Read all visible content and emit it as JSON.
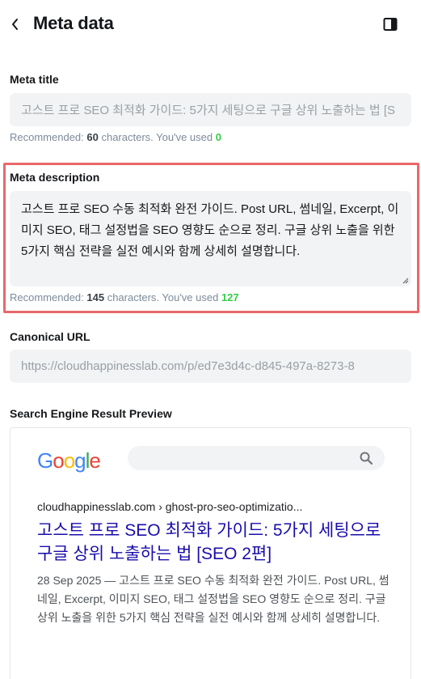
{
  "header": {
    "title": "Meta data",
    "back_icon": "chevron-left-icon",
    "panel_icon": "sidebar-panel-icon"
  },
  "meta_title": {
    "label": "Meta title",
    "placeholder": "고스트 프로 SEO 최적화 가이드: 5가지 세팅으로 구글 상위 노출하는 법 [S",
    "hint_prefix": "Recommended: ",
    "recommended": "60",
    "hint_mid": " characters. You've used ",
    "used": "0"
  },
  "meta_description": {
    "label": "Meta description",
    "value": "고스트 프로 SEO 수동 최적화 완전 가이드. Post URL, 썸네일, Excerpt, 이미지 SEO, 태그 설정법을 SEO 영향도 순으로 정리. 구글 상위 노출을 위한 5가지 핵심 전략을 실전 예시와 함께 상세히 설명합니다.",
    "hint_prefix": "Recommended: ",
    "recommended": "145",
    "hint_mid": " characters. You've used ",
    "used": "127"
  },
  "canonical": {
    "label": "Canonical URL",
    "placeholder": "https://cloudhappinesslab.com/p/ed7e3d4c-d845-497a-8273-8"
  },
  "preview": {
    "label": "Search Engine Result Preview",
    "logo_text": "Google",
    "search_icon": "magnifier-icon",
    "url": "cloudhappinesslab.com › ghost-pro-seo-optimizatio...",
    "title": "고스트 프로 SEO 최적화 가이드: 5가지 세팅으로 구글 상위 노출하는 법 [SEO 2편]",
    "description": "28 Sep 2025 — 고스트 프로 SEO 수동 최적화 완전 가이드. Post URL, 썸네일, Excerpt, 이미지 SEO, 태그 설정법을 SEO 영향도 순으로 정리. 구글 상위 노출을 위한 5가지 핵심 전략을 실전 예시와 함께 상세히 설명합니다."
  },
  "colors": {
    "highlight": "#e8686a",
    "used_ok": "#30cf43",
    "link_blue": "#1a0dab"
  }
}
